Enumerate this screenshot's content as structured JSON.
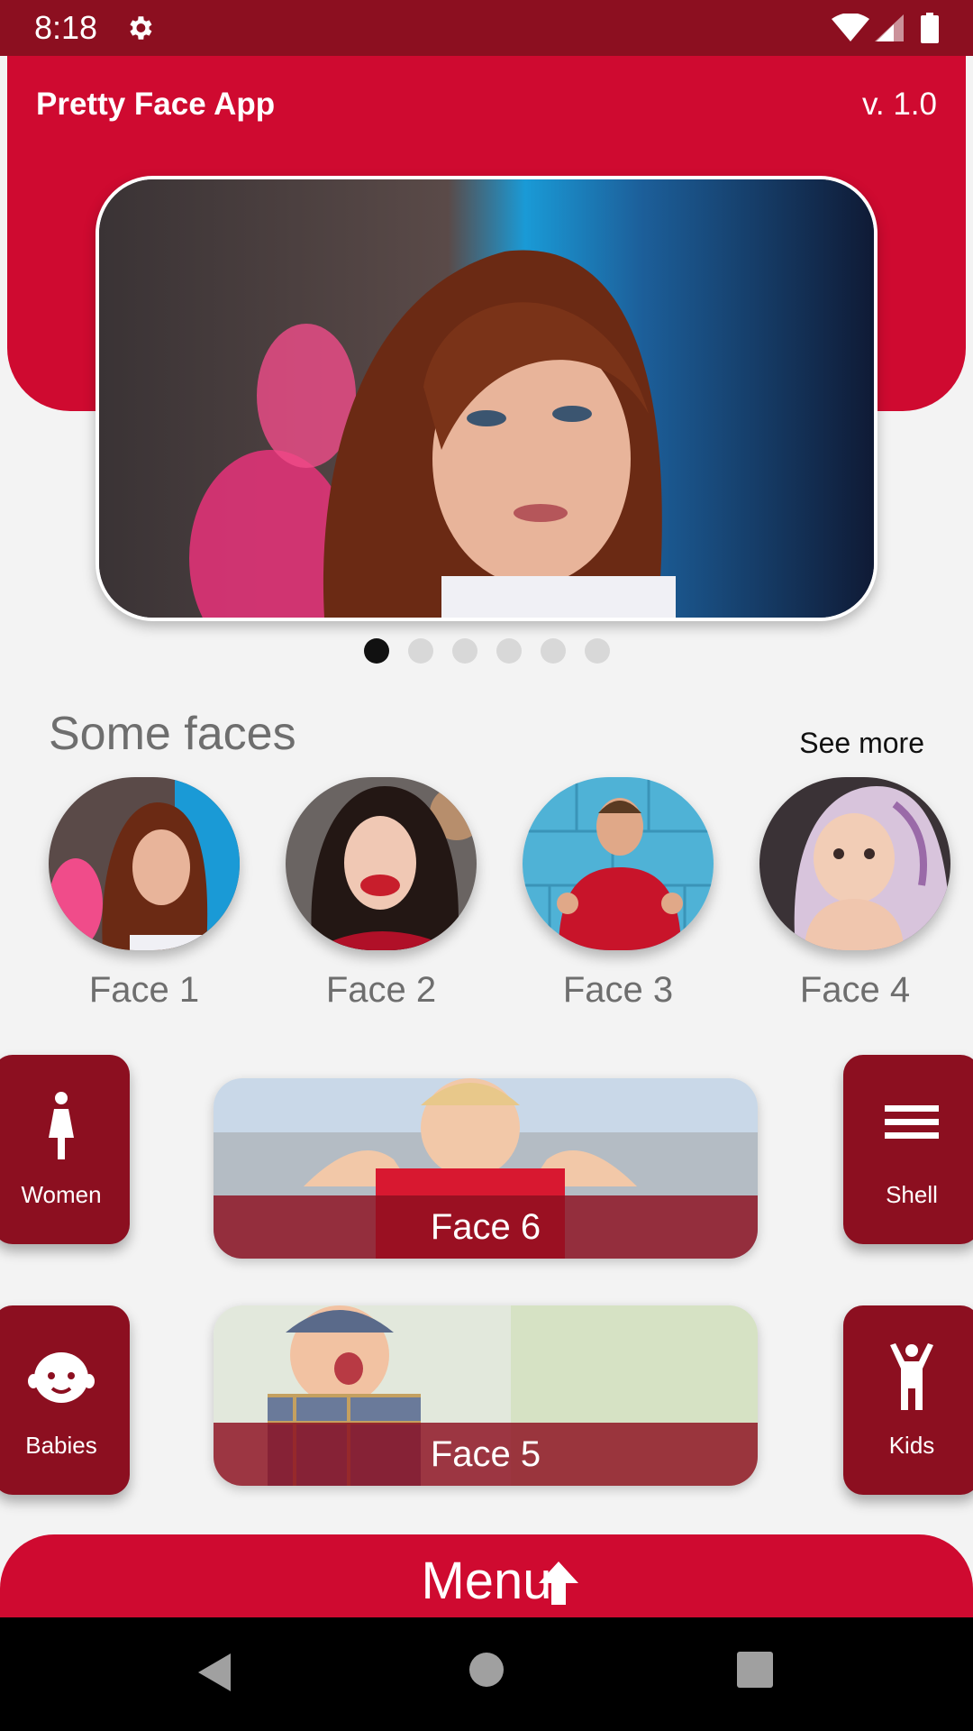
{
  "status_bar": {
    "time": "8:18"
  },
  "header": {
    "title": "Pretty Face App",
    "version": "v. 1.0"
  },
  "carousel": {
    "page_count": 6,
    "active_index": 0
  },
  "faces_section": {
    "title": "Some faces",
    "see_more": "See more",
    "items": [
      {
        "label": "Face 1"
      },
      {
        "label": "Face 2"
      },
      {
        "label": "Face 3"
      },
      {
        "label": "Face 4"
      }
    ]
  },
  "categories": {
    "women": "Women",
    "shell": "Shell",
    "babies": "Babies",
    "kids": "Kids"
  },
  "cards": {
    "top": "Face 6",
    "bottom": "Face 5"
  },
  "menu": {
    "label": "Menu"
  },
  "colors": {
    "primary": "#cf0a30",
    "dark": "#8c0f20",
    "background": "#f3f3f3"
  }
}
